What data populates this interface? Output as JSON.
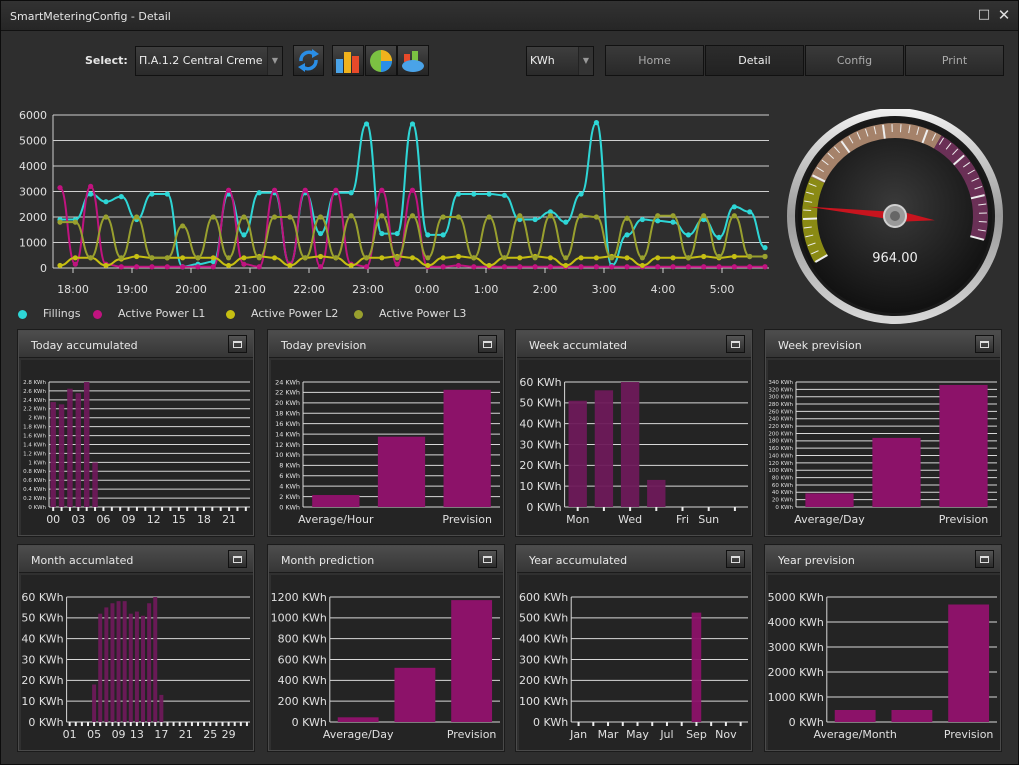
{
  "window": {
    "title": "SmartMeteringConfig - Detail"
  },
  "toolbar": {
    "select_label": "Select:",
    "site_value": "Π.Α.1.2 Central Creme",
    "unit_value": "KWh",
    "icons": [
      "refresh-icon",
      "bar-chart-icon",
      "pie-chart-icon",
      "stacked-chart-icon"
    ]
  },
  "nav": {
    "home": "Home",
    "detail": "Detail",
    "config": "Config",
    "print": "Print"
  },
  "main_chart": {
    "type": "line",
    "y_ticks": [
      "6000",
      "5000",
      "4000",
      "3000",
      "2000",
      "1000",
      "0"
    ],
    "x_ticks": [
      "18:00",
      "19:00",
      "20:00",
      "21:00",
      "22:00",
      "23:00",
      "0:00",
      "1:00",
      "2:00",
      "3:00",
      "4:00",
      "5:00"
    ],
    "ylim": [
      0,
      6000
    ],
    "legend": [
      {
        "name": "Fillings",
        "color": "#2ed6d6"
      },
      {
        "name": "Active Power L1",
        "color": "#c0137f"
      },
      {
        "name": "Active Power L2",
        "color": "#c6bf12"
      },
      {
        "name": "Active Power L3",
        "color": "#99a02e"
      }
    ],
    "series": [
      {
        "name": "Fillings",
        "color": "#2ed6d6",
        "values": [
          1900,
          1900,
          2900,
          2600,
          2800,
          1900,
          2900,
          2900,
          50,
          150,
          250,
          2900,
          1300,
          2950,
          2950,
          150,
          2950,
          1350,
          2950,
          2950,
          5650,
          1350,
          1350,
          5650,
          1300,
          1300,
          2900,
          2900,
          2900,
          2850,
          1900,
          1900,
          2200,
          1800,
          2900,
          5700,
          100,
          1300,
          1900,
          1850,
          1800,
          1300,
          1900,
          1200,
          2400,
          2200,
          800
        ]
      },
      {
        "name": "Active Power L1",
        "color": "#c0137f",
        "values": [
          3150,
          150,
          3200,
          150,
          50,
          50,
          50,
          50,
          50,
          50,
          50,
          3050,
          150,
          50,
          3050,
          150,
          3050,
          50,
          3050,
          150,
          50,
          3050,
          150,
          3050,
          50,
          50,
          100,
          50,
          50,
          50,
          50,
          50,
          50,
          50,
          50,
          50,
          50,
          50,
          50,
          50,
          50,
          50,
          50,
          50,
          50,
          50,
          50
        ]
      },
      {
        "name": "Active Power L2",
        "color": "#c6bf12",
        "values": [
          100,
          400,
          400,
          100,
          350,
          450,
          400,
          400,
          400,
          400,
          400,
          100,
          400,
          450,
          400,
          100,
          400,
          450,
          400,
          100,
          400,
          400,
          450,
          400,
          100,
          400,
          450,
          400,
          100,
          400,
          400,
          450,
          400,
          100,
          400,
          400,
          450,
          400,
          100,
          400,
          400,
          400,
          450,
          400,
          450,
          450,
          450
        ]
      },
      {
        "name": "Active Power L3",
        "color": "#99a02e",
        "values": [
          1800,
          1800,
          400,
          2000,
          400,
          2000,
          400,
          400,
          1650,
          400,
          2000,
          400,
          2000,
          400,
          2000,
          2000,
          400,
          2000,
          400,
          2050,
          400,
          2050,
          400,
          2050,
          400,
          2000,
          2000,
          400,
          2000,
          400,
          2050,
          400,
          2050,
          400,
          2050,
          2000,
          400,
          1950,
          400,
          2050,
          2050,
          400,
          2050,
          450,
          2050,
          450,
          450
        ]
      }
    ]
  },
  "gauge": {
    "value_text": "964.00",
    "value": 964,
    "max": 6000
  },
  "panels": [
    {
      "title": "Today accumulated",
      "y_ticks": [
        "2.8 KWh",
        "2.6 KWh",
        "2.4 KWh",
        "2.2 KWh",
        "2 KWh",
        "1.8 KWh",
        "1.6 KWh",
        "1.4 KWh",
        "1.2 KWh",
        "1 KWh",
        "0.8 KWh",
        "0.6 KWh",
        "0.4 KWh",
        "0.2 KWh",
        "0 KWh"
      ],
      "x_ticks": [
        "00",
        "03",
        "06",
        "09",
        "12",
        "15",
        "18",
        "21"
      ],
      "ylim": [
        0,
        2.8
      ],
      "values": [
        2.35,
        2.3,
        2.65,
        2.55,
        2.8,
        1.0
      ]
    },
    {
      "title": "Today prevision",
      "y_ticks": [
        "24 KWh",
        "22 KWh",
        "20 KWh",
        "18 KWh",
        "16 KWh",
        "14 KWh",
        "12 KWh",
        "10 KWh",
        "8 KWh",
        "6 KWh",
        "4 KWh",
        "2 KWh",
        "0 KWh"
      ],
      "x_ticks": [
        "Average/Hour",
        "Prevision"
      ],
      "ylim": [
        0,
        24
      ],
      "values": [
        2.3,
        13.5,
        22.5
      ]
    },
    {
      "title": "Week accumlated",
      "y_ticks": [
        "60 KWh",
        "50 KWh",
        "40 KWh",
        "30 KWh",
        "20 KWh",
        "10 KWh",
        "0 KWh"
      ],
      "x_ticks": [
        "Mon",
        "Wed",
        "Fri",
        "Sun"
      ],
      "ylim": [
        0,
        60
      ],
      "values": [
        51,
        56,
        60,
        13
      ]
    },
    {
      "title": "Week prevision",
      "y_ticks": [
        "340 KWh",
        "320 KWh",
        "300 KWh",
        "280 KWh",
        "260 KWh",
        "240 KWh",
        "220 KWh",
        "200 KWh",
        "180 KWh",
        "160 KWh",
        "140 KWh",
        "120 KWh",
        "100 KWh",
        "80 KWh",
        "60 KWh",
        "40 KWh",
        "20 KWh",
        "0 KWh"
      ],
      "x_ticks": [
        "Average/Day",
        "Prevision"
      ],
      "ylim": [
        0,
        340
      ],
      "values": [
        37,
        188,
        332
      ]
    },
    {
      "title": "Month accumlated",
      "y_ticks": [
        "60 KWh",
        "50 KWh",
        "40 KWh",
        "30 KWh",
        "20 KWh",
        "10 KWh",
        "0 KWh"
      ],
      "x_ticks": [
        "01",
        "05",
        "09",
        "13",
        "17",
        "21",
        "25",
        "29"
      ],
      "ylim": [
        0,
        60
      ],
      "values": [
        18,
        52,
        55,
        57,
        58,
        58,
        52,
        53,
        51,
        57,
        60,
        13
      ]
    },
    {
      "title": "Month prediction",
      "y_ticks": [
        "1200 KWh",
        "1000 KWh",
        "800 KWh",
        "600 KWh",
        "400 KWh",
        "200 KWh",
        "0 KWh"
      ],
      "x_ticks": [
        "Average/Day",
        "Prevision"
      ],
      "ylim": [
        0,
        1200
      ],
      "values": [
        45,
        520,
        1170
      ]
    },
    {
      "title": "Year accumulated",
      "y_ticks": [
        "600 KWh",
        "500 KWh",
        "400 KWh",
        "300 KWh",
        "200 KWh",
        "100 KWh",
        "0 KWh"
      ],
      "x_ticks": [
        "Jan",
        "Mar",
        "May",
        "Jul",
        "Sep",
        "Nov"
      ],
      "ylim": [
        0,
        600
      ],
      "values": [
        0,
        0,
        0,
        0,
        0,
        0,
        0,
        0,
        525,
        0,
        0,
        0
      ]
    },
    {
      "title": "Year prevision",
      "y_ticks": [
        "5000 KWh",
        "4000 KWh",
        "3000 KWh",
        "2000 KWh",
        "1000 KWh",
        "0 KWh"
      ],
      "x_ticks": [
        "Average/Month",
        "Prevision"
      ],
      "ylim": [
        0,
        5000
      ],
      "values": [
        480,
        480,
        4700
      ]
    }
  ]
}
